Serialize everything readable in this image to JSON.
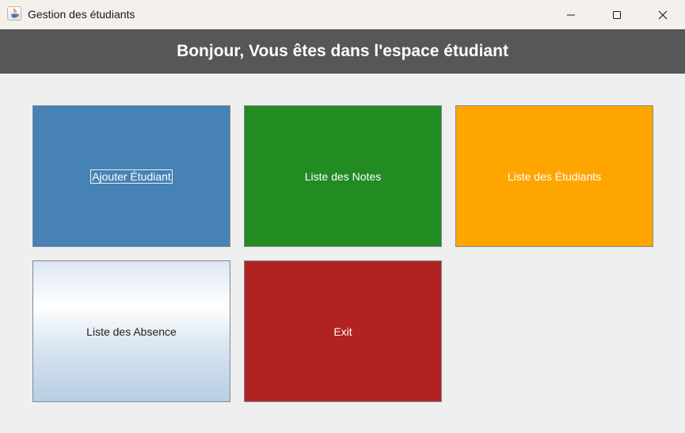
{
  "window": {
    "title": "Gestion des étudiants",
    "icon": "java-cup-icon",
    "controls": [
      "minimize-icon",
      "maximize-icon",
      "close-icon"
    ]
  },
  "header": {
    "title": "Bonjour, Vous êtes dans l'espace étudiant",
    "background": "#575757"
  },
  "tiles": [
    {
      "label": "Ajouter Étudiant",
      "color": "#4682b4",
      "focused": true
    },
    {
      "label": "Liste des Notes",
      "color": "#228b22"
    },
    {
      "label": "Liste des Étudiants",
      "color": "#ffa500"
    },
    {
      "label": "Liste des Absence",
      "color": "gradient-light-blue"
    },
    {
      "label": "Exit",
      "color": "#b22222"
    }
  ]
}
